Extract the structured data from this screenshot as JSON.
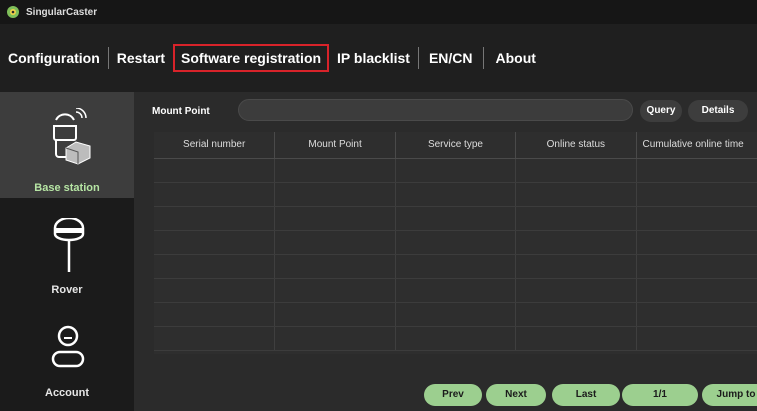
{
  "app": {
    "title": "SingularCaster"
  },
  "menu": [
    {
      "label": "Configuration"
    },
    {
      "label": "Restart"
    },
    {
      "label": "Software registration"
    },
    {
      "label": "IP blacklist"
    },
    {
      "label": "EN/CN"
    },
    {
      "label": "About"
    }
  ],
  "sidebar": {
    "items": [
      {
        "label": "Base station",
        "icon": "base-station-icon"
      },
      {
        "label": "Rover",
        "icon": "rover-icon"
      },
      {
        "label": "Account",
        "icon": "account-icon"
      }
    ]
  },
  "search": {
    "label": "Mount Point",
    "value": "",
    "query_label": "Query",
    "details_label": "Details"
  },
  "table": {
    "columns": [
      "Serial number",
      "Mount Point",
      "Service type",
      "Online status",
      "Cumulative online time"
    ],
    "rows": []
  },
  "pagination": {
    "prev_label": "Prev",
    "next_label": "Next",
    "last_label": "Last",
    "page_indicator": "1/1",
    "jump_label": "Jump to"
  },
  "colors": {
    "accent_green": "#9ccf8f",
    "active_menu_border": "#d8232a",
    "active_nav_text": "#b6e5a4"
  }
}
